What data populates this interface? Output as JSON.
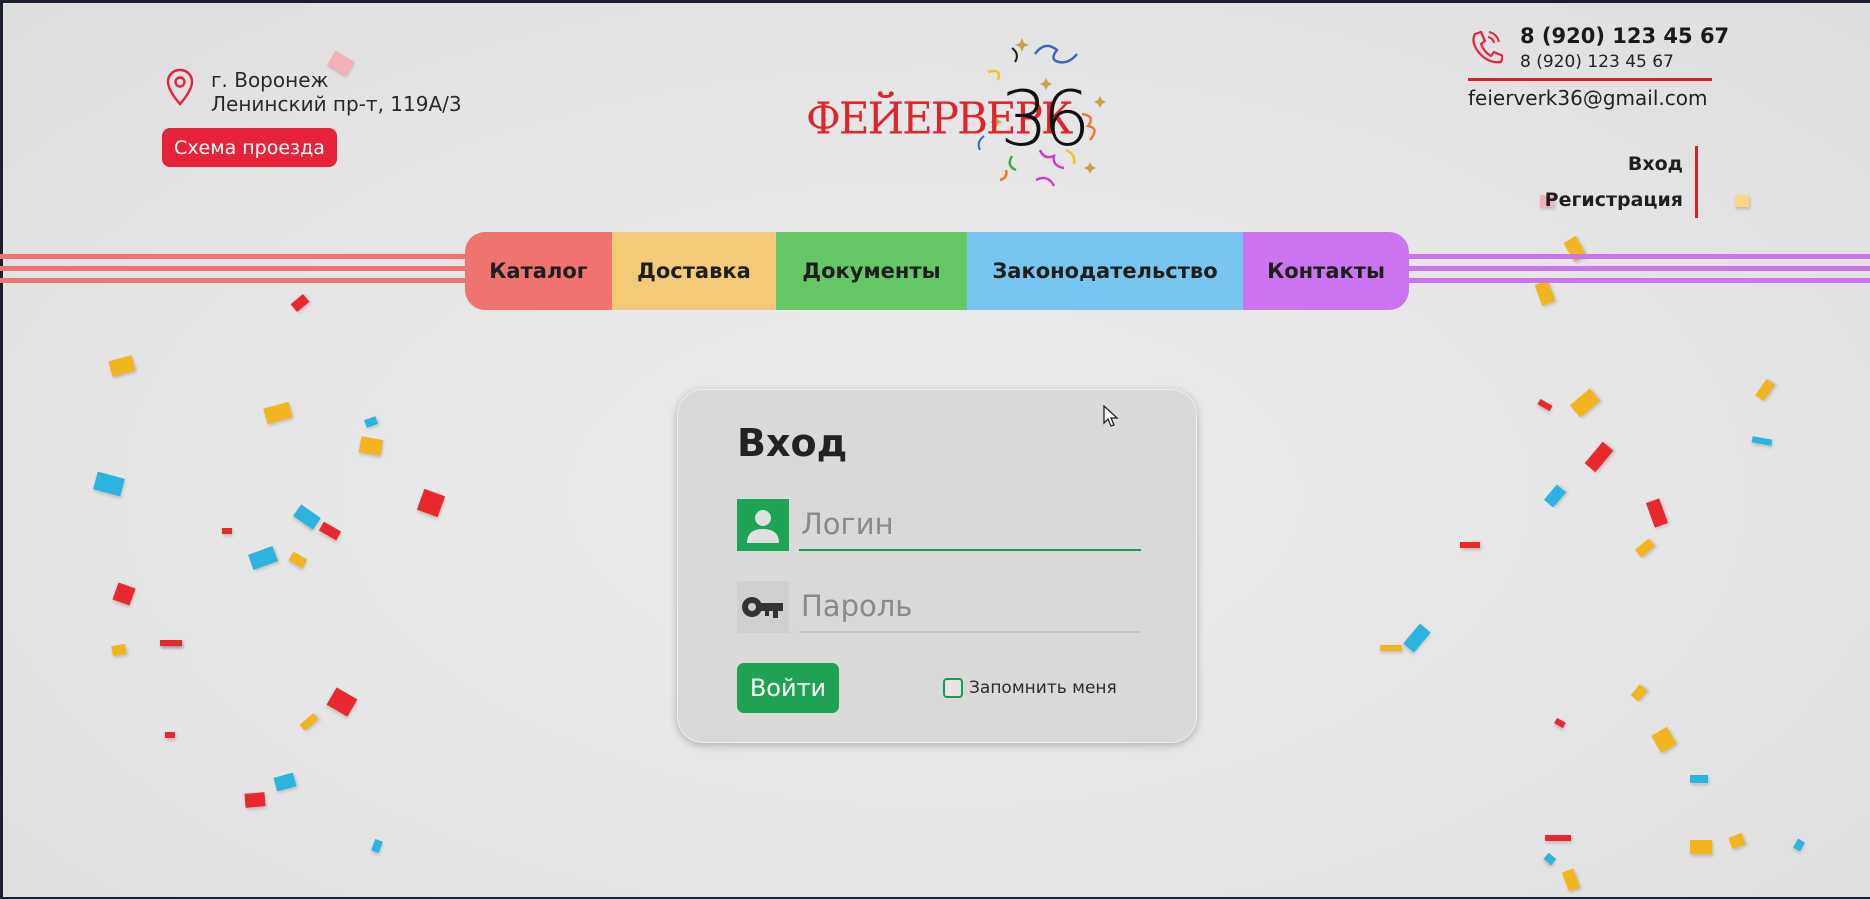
{
  "header": {
    "address_line1": "г. Воронеж",
    "address_line2": "Ленинский пр-т, 119А/3",
    "route_button": "Схема проезда",
    "logo_text": "ФЕЙЕРВЕРК",
    "logo_number": "36",
    "phone_main": "8 (920) 123 45 67",
    "phone_sub": "8 (920) 123 45 67",
    "email": "feierverk36@gmail.com",
    "login_link": "Вход",
    "register_link": "Регистрация",
    "icons": [
      "map-pin-icon",
      "phone-icon"
    ],
    "accent_color": "#e62338"
  },
  "nav": {
    "items": [
      {
        "label": "Каталог",
        "color": "#ef7470"
      },
      {
        "label": "Доставка",
        "color": "#f2ca78"
      },
      {
        "label": "Документы",
        "color": "#66c766"
      },
      {
        "label": "Законодательство",
        "color": "#78c6f0"
      },
      {
        "label": "Контакты",
        "color": "#cc74ef"
      }
    ]
  },
  "login_form": {
    "title": "Вход",
    "login_placeholder": "Логин",
    "password_placeholder": "Пароль",
    "submit_label": "Войти",
    "remember_label": "Запомнить меня",
    "remember_checked": false,
    "icons": [
      "user-icon",
      "key-icon"
    ],
    "button_color": "#1ea353"
  }
}
